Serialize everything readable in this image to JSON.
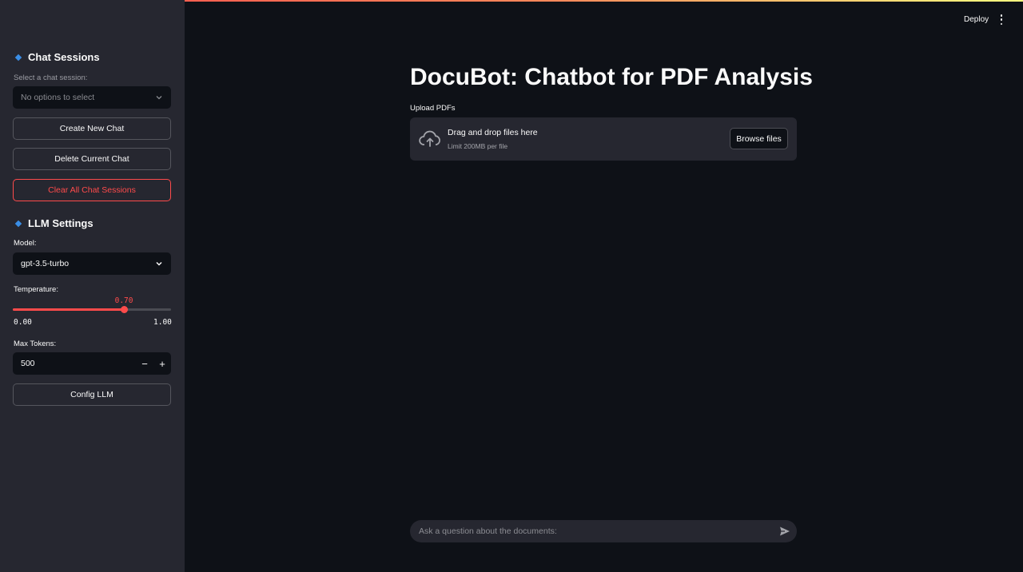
{
  "header": {
    "deploy_label": "Deploy",
    "menu_icon": "kebab-menu-icon"
  },
  "sidebar": {
    "chat_sessions": {
      "heading": "Chat Sessions",
      "select_label": "Select a chat session:",
      "select_placeholder": "No options to select",
      "create_button": "Create New Chat",
      "delete_button": "Delete Current Chat",
      "clear_button": "Clear All Chat Sessions"
    },
    "llm_settings": {
      "heading": "LLM Settings",
      "model_label": "Model:",
      "model_value": "gpt-3.5-turbo",
      "temperature_label": "Temperature:",
      "temperature": {
        "value": 0.7,
        "value_text": "0.70",
        "min_text": "0.00",
        "max_text": "1.00",
        "min": 0,
        "max": 1
      },
      "max_tokens_label": "Max Tokens:",
      "max_tokens_value": "500",
      "decrement_symbol": "−",
      "increment_symbol": "+",
      "config_button": "Config LLM"
    }
  },
  "main": {
    "title": "DocuBot: Chatbot for PDF Analysis",
    "upload": {
      "label": "Upload PDFs",
      "drop_text": "Drag and drop files here",
      "limit_text": "Limit 200MB per file",
      "browse_button": "Browse files"
    },
    "chat_input": {
      "placeholder": "Ask a question about the documents:"
    }
  },
  "colors": {
    "accent": "#ff4b4b",
    "sidebar_bg": "#262730",
    "main_bg": "#0e1117",
    "heading_diamond": "#3a8ee6"
  }
}
